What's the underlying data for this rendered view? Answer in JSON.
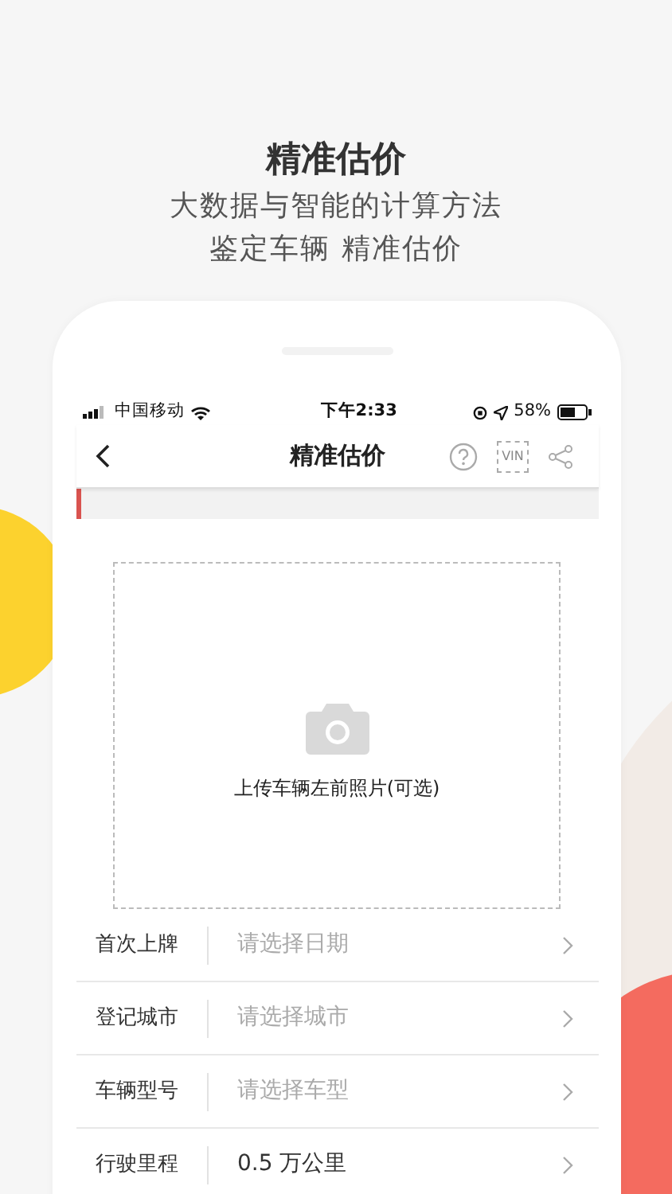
{
  "headline": "精准估价",
  "subtitle_lines": [
    "大数据与智能的计算方法",
    "鉴定车辆 精准估价"
  ],
  "status_bar": {
    "carrier": "中国移动",
    "time": "下午2:33",
    "battery": "58%"
  },
  "nav": {
    "title": "精准估价",
    "vin_label": "VIN"
  },
  "upload": {
    "label": "上传车辆左前照片(可选)"
  },
  "fields": [
    {
      "label": "首次上牌",
      "placeholder": "请选择日期"
    },
    {
      "label": "登记城市",
      "placeholder": "请选择城市"
    },
    {
      "label": "车辆型号",
      "placeholder": "请选择车型"
    },
    {
      "label": "行驶里程",
      "value": "0.5 万公里"
    }
  ]
}
